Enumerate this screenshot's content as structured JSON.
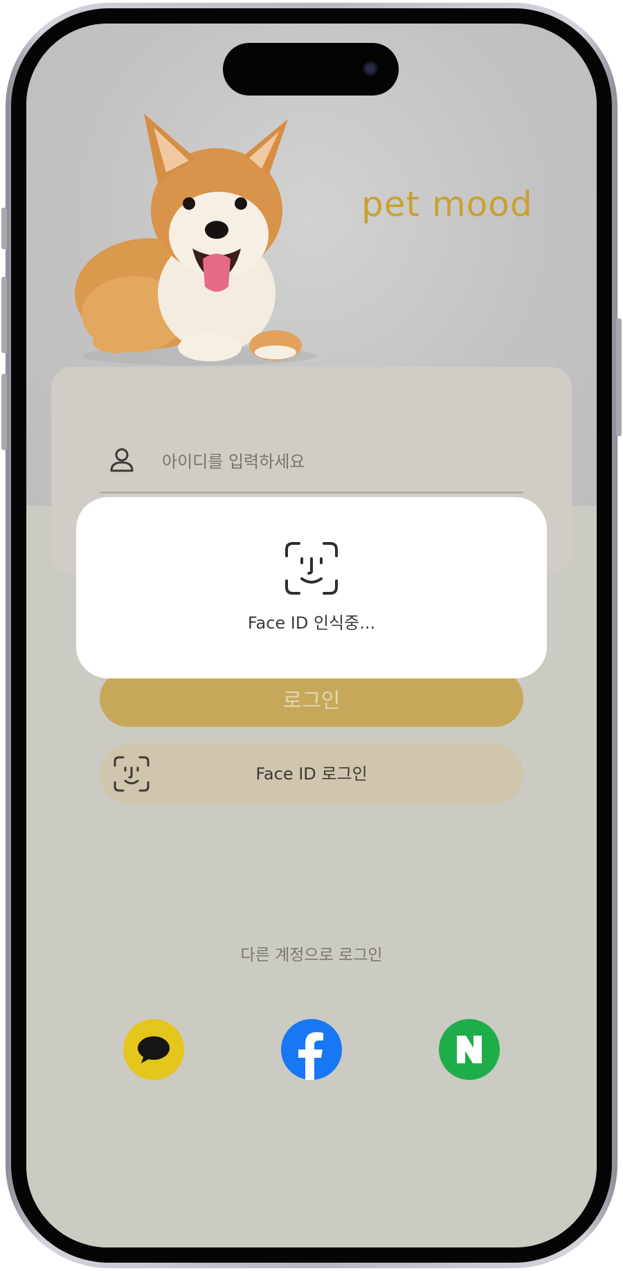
{
  "app": {
    "brand_name": "pet mood",
    "brand_color": "#c9a12f",
    "background_color": "#cbcac3"
  },
  "login_form": {
    "id_field": {
      "placeholder": "아이디를 입력하세요",
      "value": "",
      "icon": "user-icon"
    },
    "login_button_label": "로그인",
    "faceid_button_label": "Face ID 로그인",
    "faceid_button_icon": "face-id-icon"
  },
  "faceid_modal": {
    "icon": "face-id-icon",
    "status_text": "Face ID 인식중..."
  },
  "social_login": {
    "label": "다른 계정으로 로그인",
    "providers": [
      {
        "name": "kakao",
        "icon": "kakao-talk-icon",
        "color": "#e4c61c"
      },
      {
        "name": "facebook",
        "icon": "facebook-icon",
        "color": "#1877f2"
      },
      {
        "name": "naver",
        "icon": "naver-icon",
        "color": "#1fad4a"
      }
    ]
  }
}
